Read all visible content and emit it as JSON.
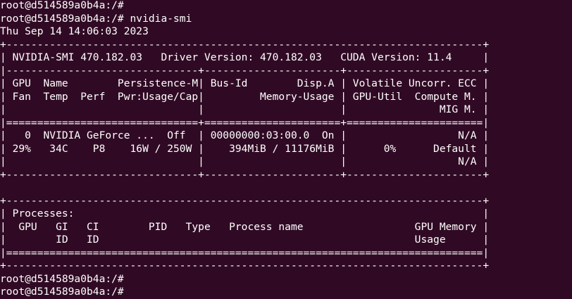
{
  "terminal": {
    "background": "#300a24",
    "foreground": "#ffffff",
    "lines": [
      "root@d514589a0b4a:/#",
      "root@d514589a0b4a:/# nvidia-smi",
      "Thu Sep 14 14:06:03 2023",
      "+-----------------------------------------------------------------------------+",
      "| NVIDIA-SMI 470.182.03   Driver Version: 470.182.03   CUDA Version: 11.4     |",
      "|-------------------------------+----------------------+----------------------+",
      "| GPU  Name        Persistence-M| Bus-Id        Disp.A | Volatile Uncorr. ECC |",
      "| Fan  Temp  Perf  Pwr:Usage/Cap|         Memory-Usage | GPU-Util  Compute M. |",
      "|                               |                      |               MIG M. |",
      "|===============================+======================+======================|",
      "|   0  NVIDIA GeForce ...  Off  | 00000000:03:00.0  On |                  N/A |",
      "| 29%   34C    P8    16W / 250W |    394MiB / 11176MiB |      0%      Default |",
      "|                               |                      |                  N/A |",
      "+-------------------------------+----------------------+----------------------+",
      "",
      "+-----------------------------------------------------------------------------+",
      "| Processes:                                                                  |",
      "|  GPU   GI   CI        PID   Type   Process name                  GPU Memory |",
      "|        ID   ID                                                   Usage      |",
      "|=============================================================================|",
      "+-----------------------------------------------------------------------------+",
      "root@d514589a0b4a:/#",
      "root@d514589a0b4a:/#"
    ]
  }
}
